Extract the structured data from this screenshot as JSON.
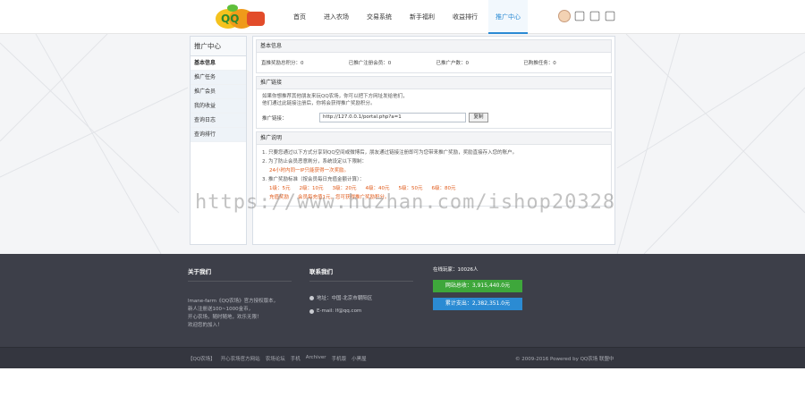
{
  "nav": {
    "items": [
      "首页",
      "进入农场",
      "交易系统",
      "新手福利",
      "收益排行",
      "推广中心"
    ],
    "active_index": 5
  },
  "sidebar": {
    "title": "推广中心",
    "items": [
      "基本信息",
      "推广任务",
      "推广会员",
      "我的收益",
      "查询日志",
      "查询排行"
    ]
  },
  "basic": {
    "head": "基本信息",
    "stats": [
      "直推奖励总积分：0",
      "已推广注册会员：0",
      "已推广户数：0",
      "已购推任务：0"
    ]
  },
  "promo": {
    "head": "推广链接",
    "intro1": "如果你想推荐其他朋友来玩QQ农场，你可以把下方网址发给他们，",
    "intro2": "他们通过此链接注册后，你将会获得推广奖励积分。",
    "link_label": "推广链接：",
    "link_value": "http://127.0.0.1/portal.php?a=1",
    "copy_label": "复制"
  },
  "rules": {
    "head": "推广说明",
    "line1": "1. 只要您通过以下方式分享到QQ空间或微博后，朋友通过链接注册即可为您带来推广奖励，奖励直接存入您的账户。",
    "line2": "2. 为了防止会员恶意刷分，系统设定以下限制：",
    "line2_sub": "24小时内同一IP只能获得一次奖励。",
    "line3": "3. 推广奖励标准（按会员每日充值金额计算）：",
    "rewards": [
      "1级：5元",
      "2级：10元",
      "3级：20元",
      "4级：40元",
      "5级：50元",
      "6级：80元"
    ],
    "line4": "充值奖励",
    "line4_sub": "会员每充值1元，您可获得推广奖励积分。"
  },
  "watermark": "https://www.huzhan.com/ishop20328",
  "footer": {
    "about_head": "关于我们",
    "about_lines": [
      "lmane-farm《QQ农场》官方授权版本，",
      "新人注册送100~1000金币，",
      "开心农场，随时随地，欢乐无限！",
      "欢迎您的加入！"
    ],
    "contact_head": "联系我们",
    "contact_address": "地址：中国·北京市朝阳区",
    "contact_email": "E-mail: lf@qq.com",
    "stat_label": "在线玩家：10026人",
    "btn_green": "网站总收：3,915,440.0元",
    "btn_blue": "累计支出：2,382,351.0元"
  },
  "bottom": {
    "links": [
      "【QQ农场】",
      "开心农场官方网站",
      "农场论坛",
      "手机",
      "Archiver",
      "手机版",
      "小黑屋"
    ],
    "copyright": "© 2009-2016 Powered by QQ农场 联盟中"
  }
}
